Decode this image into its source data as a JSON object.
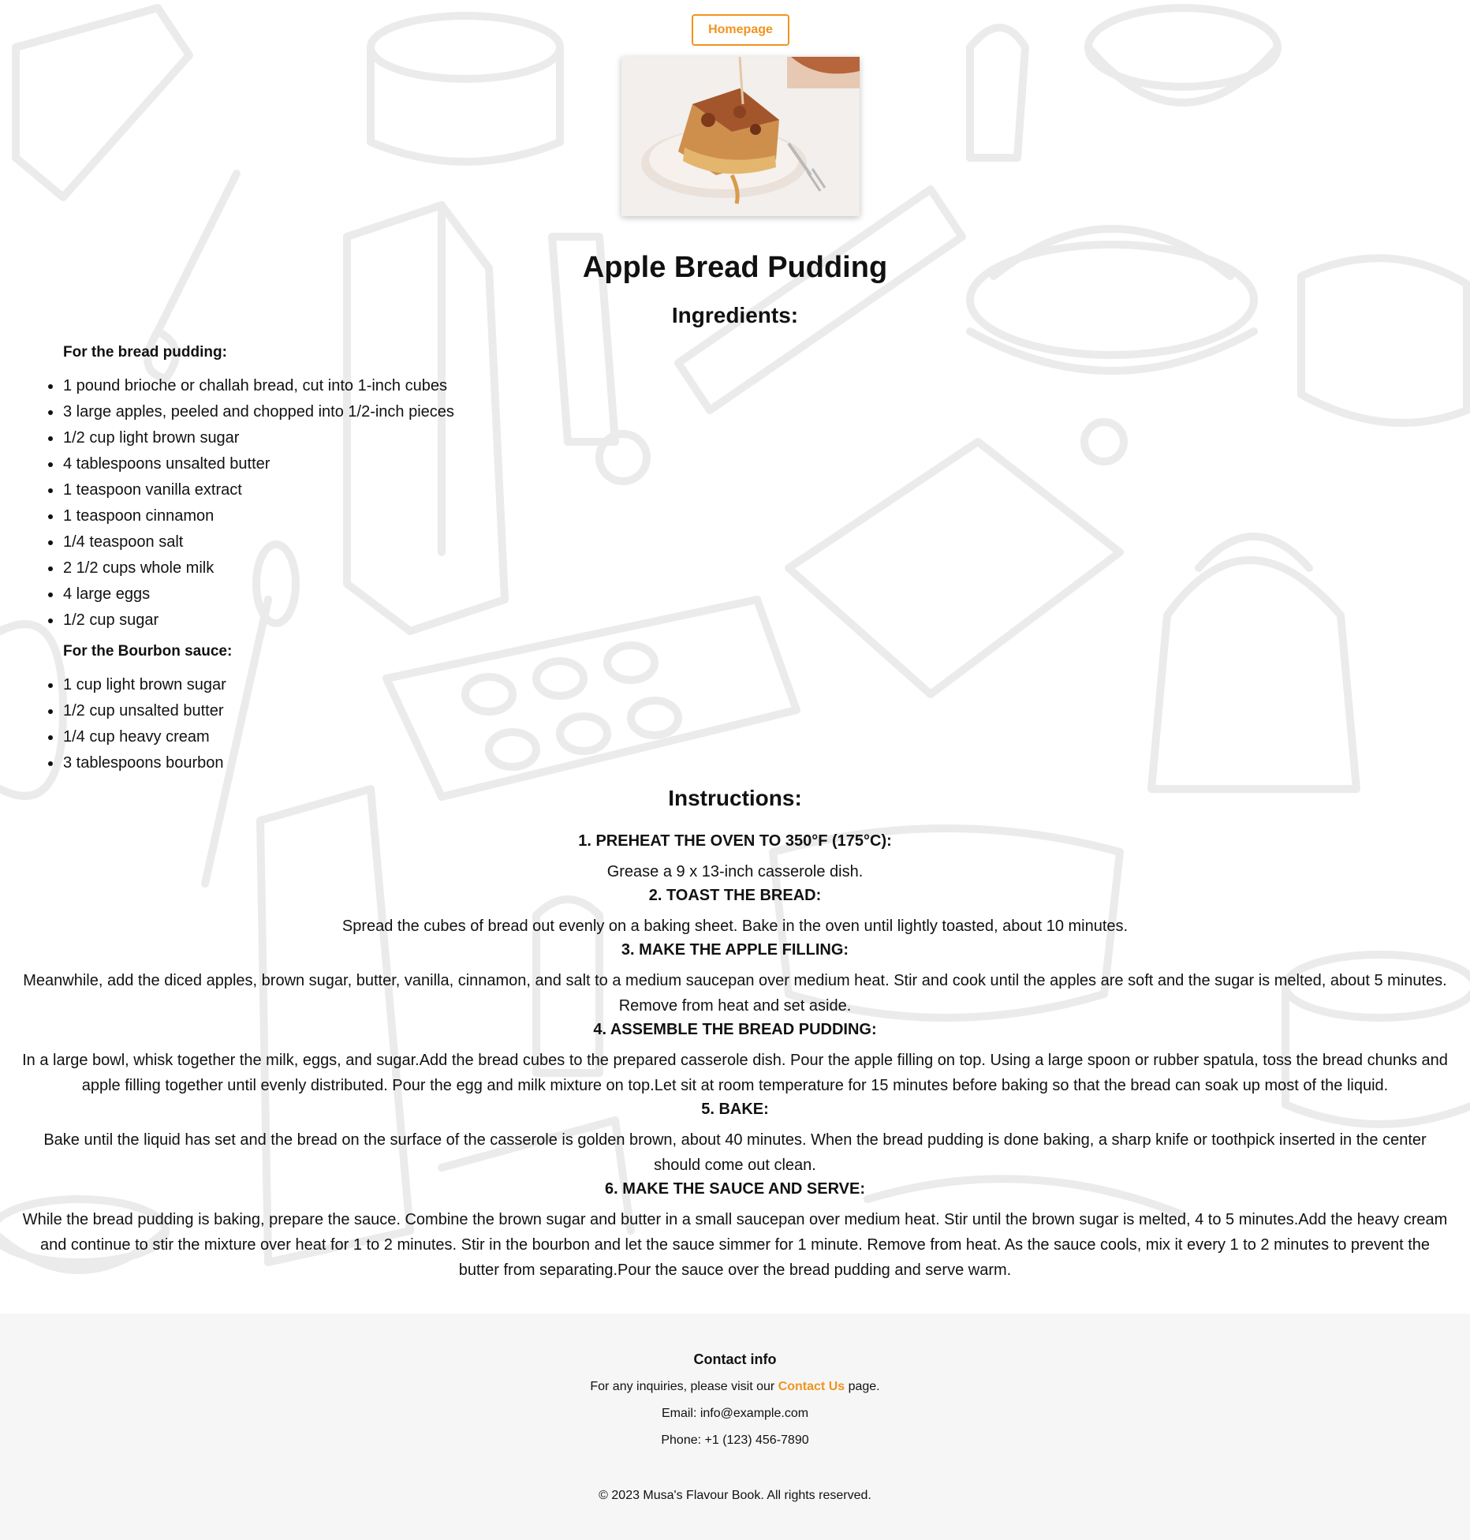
{
  "nav": {
    "home_label": "Homepage"
  },
  "recipe": {
    "title": "Apple Bread Pudding",
    "hero_image": "apple-bread-pudding-photo",
    "ingredients_heading": "Ingredients:",
    "groups": [
      {
        "title": "For the bread pudding:",
        "items": [
          "1 pound brioche or challah bread, cut into 1-inch cubes",
          "3 large apples, peeled and chopped into 1/2-inch pieces",
          "1/2 cup light brown sugar",
          "4 tablespoons unsalted butter",
          "1 teaspoon vanilla extract",
          "1 teaspoon cinnamon",
          "1/4 teaspoon salt",
          "2 1/2 cups whole milk",
          "4 large eggs",
          "1/2 cup sugar"
        ]
      },
      {
        "title": "For the Bourbon sauce:",
        "items": [
          "1 cup light brown sugar",
          "1/2 cup unsalted butter",
          "1/4 cup heavy cream",
          "3 tablespoons bourbon"
        ]
      }
    ],
    "instructions_heading": "Instructions:",
    "steps": [
      {
        "title": "1. PREHEAT THE OVEN TO 350°F (175°C):",
        "text": "Grease a 9 x 13-inch casserole dish."
      },
      {
        "title": "2. TOAST THE BREAD:",
        "text": "Spread the cubes of bread out evenly on a baking sheet. Bake in the oven until lightly toasted, about 10 minutes."
      },
      {
        "title": "3. MAKE THE APPLE FILLING:",
        "text": "Meanwhile, add the diced apples, brown sugar, butter, vanilla, cinnamon, and salt to a medium saucepan over medium heat. Stir and cook until the apples are soft and the sugar is melted, about 5 minutes. Remove from heat and set aside."
      },
      {
        "title": "4. ASSEMBLE THE BREAD PUDDING:",
        "text": "In a large bowl, whisk together the milk, eggs, and sugar.Add the bread cubes to the prepared casserole dish. Pour the apple filling on top. Using a large spoon or rubber spatula, toss the bread chunks and apple filling together until evenly distributed. Pour the egg and milk mixture on top.Let sit at room temperature for 15 minutes before baking so that the bread can soak up most of the liquid."
      },
      {
        "title": "5. BAKE:",
        "text": "Bake until the liquid has set and the bread on the surface of the casserole is golden brown, about 40 minutes. When the bread pudding is done baking, a sharp knife or toothpick inserted in the center should come out clean."
      },
      {
        "title": "6. MAKE THE SAUCE AND SERVE:",
        "text": "While the bread pudding is baking, prepare the sauce. Combine the brown sugar and butter in a small saucepan over medium heat. Stir until the brown sugar is melted, 4 to 5 minutes.Add the heavy cream and continue to stir the mixture over heat for 1 to 2 minutes. Stir in the bourbon and let the sauce simmer for 1 minute. Remove from heat. As the sauce cools, mix it every 1 to 2 minutes to prevent the butter from separating.Pour the sauce over the bread pudding and serve warm."
      }
    ]
  },
  "footer": {
    "title": "Contact info",
    "inquiry_prefix": "For any inquiries, please visit our ",
    "contact_link": "Contact Us",
    "inquiry_suffix": " page.",
    "email": "Email: info@example.com",
    "phone": "Phone: +1 (123) 456-7890",
    "copyright": "© 2023 Musa's Flavour Book. All rights reserved."
  },
  "colors": {
    "accent": "#f0941e",
    "footer_bg": "#f6f6f6",
    "text": "#111111",
    "doodle": "#ececec"
  }
}
